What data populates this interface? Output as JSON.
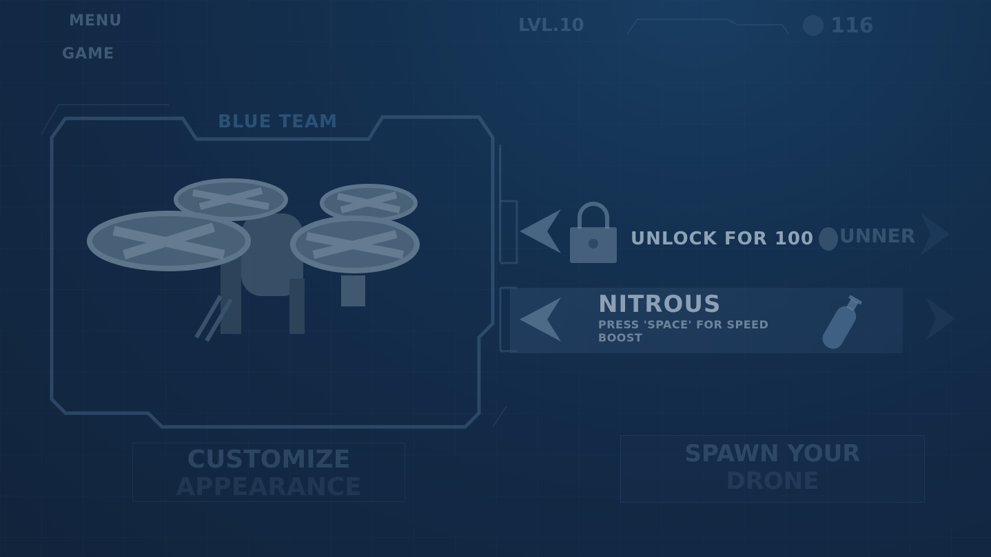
{
  "menu": {
    "items": [
      {
        "label": "MENU"
      },
      {
        "label": "GAME"
      }
    ]
  },
  "hud": {
    "level": "LVL.10",
    "coins": "116"
  },
  "team": {
    "label": "BLUE TEAM"
  },
  "drone_slot": {
    "unlock_label": "UNLOCK FOR 100",
    "next_item_partial": "UNNER"
  },
  "ability": {
    "title": "NITROUS",
    "description": "PRESS 'SPACE' FOR SPEED BOOST"
  },
  "buttons": {
    "customize_line1": "CUSTOMIZE",
    "customize_line2": "APPEARANCE",
    "spawn_line1": "SPAWN YOUR",
    "spawn_line2": "DRONE"
  },
  "colors": {
    "background": "#15304f",
    "frame_stroke": "#6f9ec4",
    "text_highlight": "#b9d2e6"
  }
}
